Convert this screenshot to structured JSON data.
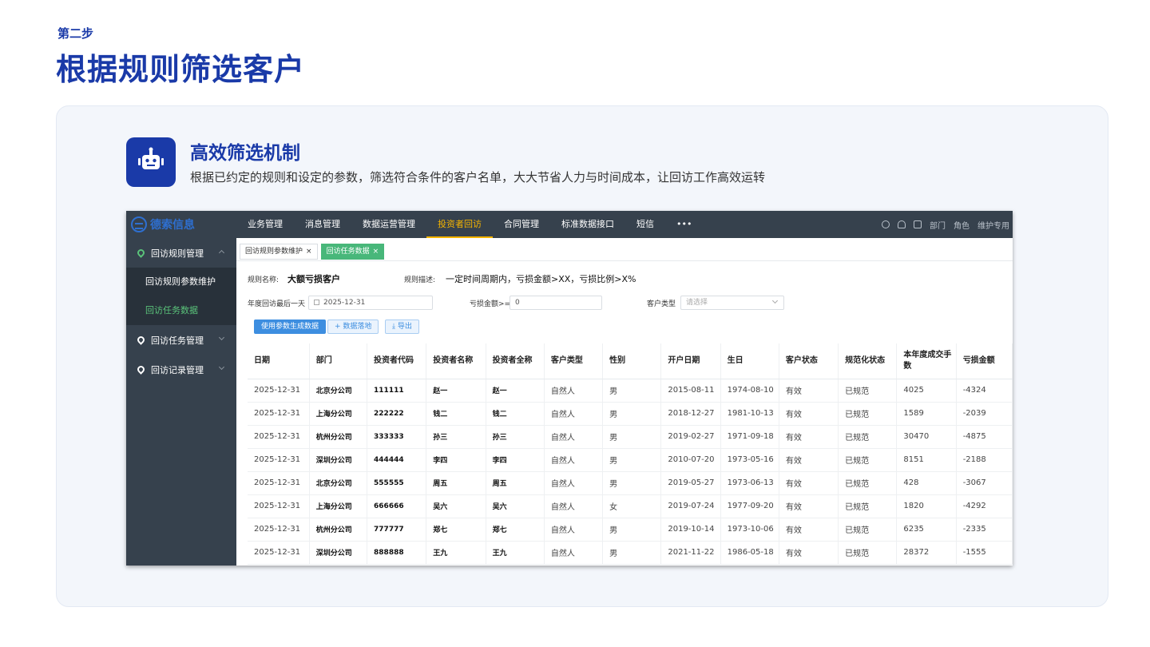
{
  "slide": {
    "step": "第二步",
    "title": "根据规则筛选客户",
    "feature_title": "高效筛选机制",
    "feature_desc": "根据已约定的规则和设定的参数，筛选符合条件的客户名单，大大节省人力与时间成本，让回访工作高效运转",
    "feature_icon": "robot-icon"
  },
  "app": {
    "logo_text": "德索信息",
    "nav": [
      "业务管理",
      "消息管理",
      "数据运营管理",
      "投资者回访",
      "合同管理",
      "标准数据接口",
      "短信",
      "•••"
    ],
    "nav_active_index": 3,
    "top_right": {
      "dept": "部门",
      "role": "角色",
      "user": "维护专用"
    },
    "sidebar": {
      "group1": "回访规则管理",
      "sub1": "回访规则参数维护",
      "sub2": "回访任务数据",
      "group2": "回访任务管理",
      "group3": "回访记录管理"
    },
    "tabs": [
      "回访规则参数维护",
      "回访任务数据"
    ],
    "form": {
      "rule_name_label": "规则名称:",
      "rule_name": "大额亏损客户",
      "rule_desc_label": "规则描述:",
      "rule_desc": "一定时间周期内，亏损金额>XX，亏损比例>X%",
      "last_day_label": "年度回访最后一天",
      "last_day": "2025-12-31",
      "loss_label": "亏损金额>=",
      "loss_value": "0",
      "cust_type_label": "客户类型",
      "cust_type_placeholder": "请选择"
    },
    "buttons": {
      "generate": "使用参数生成数据",
      "land": "+ 数据落地",
      "export": "⤓ 导出"
    },
    "colors": {
      "accent": "#1a3aa8",
      "topbar": "#36414d",
      "active_nav": "#f5b400",
      "green": "#48b77a",
      "blue_btn": "#3d8ee0"
    },
    "table": {
      "headers": [
        "日期",
        "部门",
        "投资者代码",
        "投资者名称",
        "投资者全称",
        "客户类型",
        "性别",
        "开户日期",
        "生日",
        "客户状态",
        "规范化状态",
        "本年度成交手数",
        "亏损金额"
      ],
      "rows": [
        [
          "2025-12-31",
          "北京分公司",
          "111111",
          "赵一",
          "赵一",
          "自然人",
          "男",
          "2015-08-11",
          "1974-08-10",
          "有效",
          "已规范",
          "4025",
          "-4324"
        ],
        [
          "2025-12-31",
          "上海分公司",
          "222222",
          "钱二",
          "钱二",
          "自然人",
          "男",
          "2018-12-27",
          "1981-10-13",
          "有效",
          "已规范",
          "1589",
          "-2039"
        ],
        [
          "2025-12-31",
          "杭州分公司",
          "333333",
          "孙三",
          "孙三",
          "自然人",
          "男",
          "2019-02-27",
          "1971-09-18",
          "有效",
          "已规范",
          "30470",
          "-4875"
        ],
        [
          "2025-12-31",
          "深圳分公司",
          "444444",
          "李四",
          "李四",
          "自然人",
          "男",
          "2010-07-20",
          "1973-05-16",
          "有效",
          "已规范",
          "8151",
          "-2188"
        ],
        [
          "2025-12-31",
          "北京分公司",
          "555555",
          "周五",
          "周五",
          "自然人",
          "男",
          "2019-05-27",
          "1973-06-13",
          "有效",
          "已规范",
          "428",
          "-3067"
        ],
        [
          "2025-12-31",
          "上海分公司",
          "666666",
          "吴六",
          "吴六",
          "自然人",
          "女",
          "2019-07-24",
          "1977-09-20",
          "有效",
          "已规范",
          "1820",
          "-4292"
        ],
        [
          "2025-12-31",
          "杭州分公司",
          "777777",
          "郑七",
          "郑七",
          "自然人",
          "男",
          "2019-10-14",
          "1973-10-06",
          "有效",
          "已规范",
          "6235",
          "-2335"
        ],
        [
          "2025-12-31",
          "深圳分公司",
          "888888",
          "王九",
          "王九",
          "自然人",
          "男",
          "2021-11-22",
          "1986-05-18",
          "有效",
          "已规范",
          "28372",
          "-1555"
        ]
      ]
    }
  }
}
